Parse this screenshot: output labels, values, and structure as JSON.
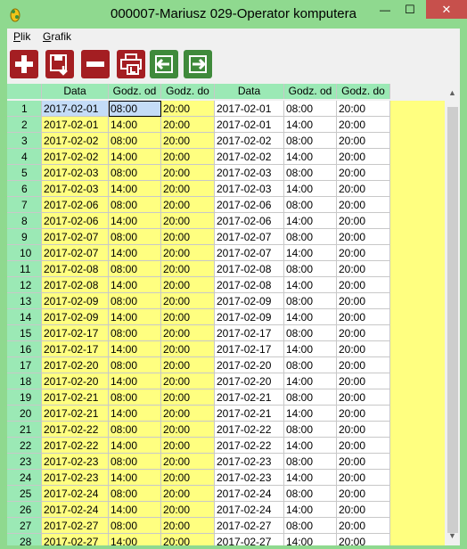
{
  "window": {
    "title": "000007-Mariusz 029-Operator komputera",
    "minimize_glyph": "—",
    "maximize_glyph": "☐",
    "close_glyph": "✕"
  },
  "menu": {
    "items": [
      {
        "label": "Plik"
      },
      {
        "label": "Grafik"
      }
    ]
  },
  "toolbar": {
    "buttons": [
      {
        "icon": "plus-icon"
      },
      {
        "icon": "save-icon"
      },
      {
        "icon": "minus-icon"
      },
      {
        "icon": "print-icon"
      },
      {
        "icon": "arrow-left-icon"
      },
      {
        "icon": "arrow-right-icon"
      }
    ]
  },
  "table": {
    "headers": [
      "",
      "Data",
      "Godz. od",
      "Godz. do",
      "Data",
      "Godz. od",
      "Godz. do"
    ],
    "rows": [
      [
        "1",
        "2017-02-01",
        "08:00",
        "20:00",
        "2017-02-01",
        "08:00",
        "20:00"
      ],
      [
        "2",
        "2017-02-01",
        "14:00",
        "20:00",
        "2017-02-01",
        "14:00",
        "20:00"
      ],
      [
        "3",
        "2017-02-02",
        "08:00",
        "20:00",
        "2017-02-02",
        "08:00",
        "20:00"
      ],
      [
        "4",
        "2017-02-02",
        "14:00",
        "20:00",
        "2017-02-02",
        "14:00",
        "20:00"
      ],
      [
        "5",
        "2017-02-03",
        "08:00",
        "20:00",
        "2017-02-03",
        "08:00",
        "20:00"
      ],
      [
        "6",
        "2017-02-03",
        "14:00",
        "20:00",
        "2017-02-03",
        "14:00",
        "20:00"
      ],
      [
        "7",
        "2017-02-06",
        "08:00",
        "20:00",
        "2017-02-06",
        "08:00",
        "20:00"
      ],
      [
        "8",
        "2017-02-06",
        "14:00",
        "20:00",
        "2017-02-06",
        "14:00",
        "20:00"
      ],
      [
        "9",
        "2017-02-07",
        "08:00",
        "20:00",
        "2017-02-07",
        "08:00",
        "20:00"
      ],
      [
        "10",
        "2017-02-07",
        "14:00",
        "20:00",
        "2017-02-07",
        "14:00",
        "20:00"
      ],
      [
        "11",
        "2017-02-08",
        "08:00",
        "20:00",
        "2017-02-08",
        "08:00",
        "20:00"
      ],
      [
        "12",
        "2017-02-08",
        "14:00",
        "20:00",
        "2017-02-08",
        "14:00",
        "20:00"
      ],
      [
        "13",
        "2017-02-09",
        "08:00",
        "20:00",
        "2017-02-09",
        "08:00",
        "20:00"
      ],
      [
        "14",
        "2017-02-09",
        "14:00",
        "20:00",
        "2017-02-09",
        "14:00",
        "20:00"
      ],
      [
        "15",
        "2017-02-17",
        "08:00",
        "20:00",
        "2017-02-17",
        "08:00",
        "20:00"
      ],
      [
        "16",
        "2017-02-17",
        "14:00",
        "20:00",
        "2017-02-17",
        "14:00",
        "20:00"
      ],
      [
        "17",
        "2017-02-20",
        "08:00",
        "20:00",
        "2017-02-20",
        "08:00",
        "20:00"
      ],
      [
        "18",
        "2017-02-20",
        "14:00",
        "20:00",
        "2017-02-20",
        "14:00",
        "20:00"
      ],
      [
        "19",
        "2017-02-21",
        "08:00",
        "20:00",
        "2017-02-21",
        "08:00",
        "20:00"
      ],
      [
        "20",
        "2017-02-21",
        "14:00",
        "20:00",
        "2017-02-21",
        "14:00",
        "20:00"
      ],
      [
        "21",
        "2017-02-22",
        "08:00",
        "20:00",
        "2017-02-22",
        "08:00",
        "20:00"
      ],
      [
        "22",
        "2017-02-22",
        "14:00",
        "20:00",
        "2017-02-22",
        "14:00",
        "20:00"
      ],
      [
        "23",
        "2017-02-23",
        "08:00",
        "20:00",
        "2017-02-23",
        "08:00",
        "20:00"
      ],
      [
        "24",
        "2017-02-23",
        "14:00",
        "20:00",
        "2017-02-23",
        "14:00",
        "20:00"
      ],
      [
        "25",
        "2017-02-24",
        "08:00",
        "20:00",
        "2017-02-24",
        "08:00",
        "20:00"
      ],
      [
        "26",
        "2017-02-24",
        "14:00",
        "20:00",
        "2017-02-24",
        "14:00",
        "20:00"
      ],
      [
        "27",
        "2017-02-27",
        "08:00",
        "20:00",
        "2017-02-27",
        "08:00",
        "20:00"
      ],
      [
        "28",
        "2017-02-27",
        "14:00",
        "20:00",
        "2017-02-27",
        "14:00",
        "20:00"
      ]
    ],
    "selected_row": 1,
    "focused_column": 2
  },
  "scrollbar": {
    "up_glyph": "▲",
    "down_glyph": "▼"
  },
  "colors": {
    "chrome": "#8fd98f",
    "header": "#9be9b5",
    "editable": "#ffff80",
    "readonly": "#ffffff",
    "selection": "#c4dcf7"
  }
}
